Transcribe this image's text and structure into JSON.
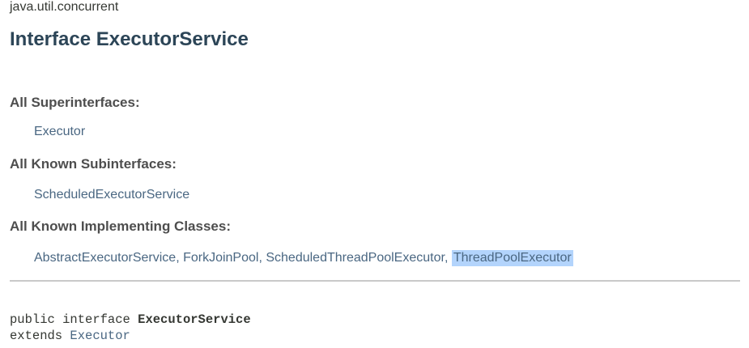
{
  "header": {
    "package": "java.util.concurrent",
    "title": "Interface ExecutorService"
  },
  "sections": {
    "superinterfaces": {
      "label": "All Superinterfaces:",
      "items": [
        "Executor"
      ]
    },
    "subinterfaces": {
      "label": "All Known Subinterfaces:",
      "items": [
        "ScheduledExecutorService"
      ]
    },
    "implementing_classes": {
      "label": "All Known Implementing Classes:",
      "items": [
        "AbstractExecutorService",
        "ForkJoinPool",
        "ScheduledThreadPoolExecutor",
        "ThreadPoolExecutor"
      ],
      "separator": ", ",
      "selected_item": "ThreadPoolExecutor"
    }
  },
  "signature": {
    "modifiers": "public interface ",
    "name": "ExecutorService",
    "extends_keyword": "extends ",
    "extends_target": "Executor"
  },
  "colors": {
    "link": "#4a6782",
    "title": "#2c4557",
    "selection": "#b3d4fc"
  }
}
